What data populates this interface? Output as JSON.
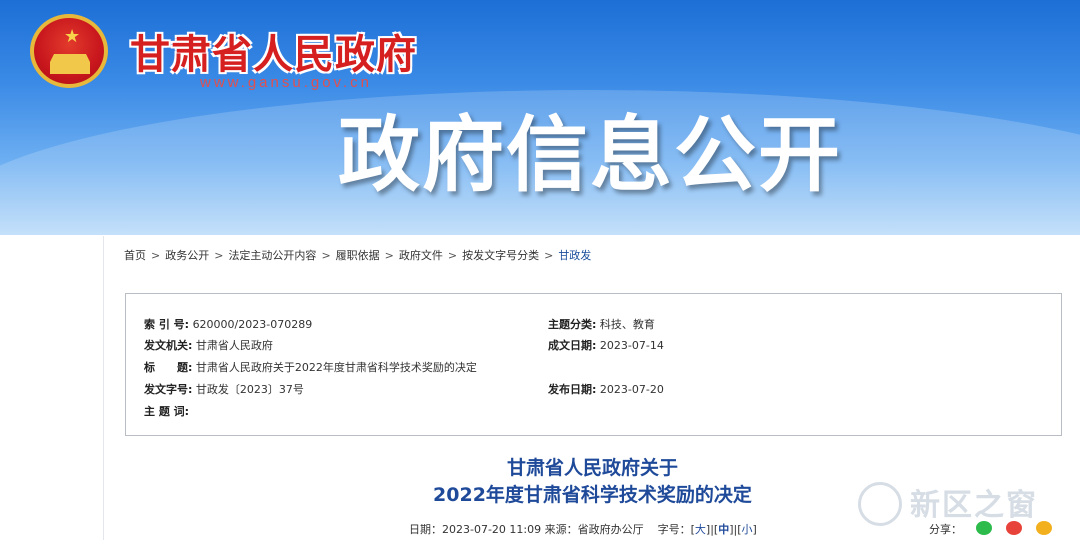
{
  "banner": {
    "site_title": "甘肃省人民政府",
    "site_url": "www.gansu.gov.cn",
    "heading": "政府信息公开"
  },
  "breadcrumb": [
    {
      "label": "首页"
    },
    {
      "label": "政务公开"
    },
    {
      "label": "法定主动公开内容"
    },
    {
      "label": "履职依据"
    },
    {
      "label": "政府文件"
    },
    {
      "label": "按发文字号分类"
    },
    {
      "label": "甘政发"
    }
  ],
  "breadcrumb_sep": ">",
  "meta": {
    "index_key": "索 引 号:",
    "index_val": "620000/2023-070289",
    "subject_key": "主题分类:",
    "subject_val": "科技、教育",
    "issuer_key": "发文机关:",
    "issuer_val": "甘肃省人民政府",
    "created_key": "成文日期:",
    "created_val": "2023-07-14",
    "title_key": "标　　题:",
    "title_val": "甘肃省人民政府关于2022年度甘肃省科学技术奖励的决定",
    "docno_key": "发文字号:",
    "docno_val": "甘政发〔2023〕37号",
    "published_key": "发布日期:",
    "published_val": "2023-07-20",
    "keywords_key": "主 题 词:",
    "keywords_val": ""
  },
  "document": {
    "title_line1": "甘肃省人民政府关于",
    "title_line2": "2022年度甘肃省科学技术奖励的决定",
    "date_label": "日期：",
    "date_value": "2023-07-20 11:09",
    "source_label": "来源：",
    "source_value": "省政府办公厅",
    "font_label": "字号：",
    "font_large": "大",
    "font_medium": "中",
    "font_small": "小",
    "share_label": "分享："
  },
  "watermark": {
    "text": "新区之窗"
  },
  "colors": {
    "banner_top": "#1d6fd6",
    "title_red": "#d61f1f",
    "doc_title_blue": "#1f4a9a"
  }
}
